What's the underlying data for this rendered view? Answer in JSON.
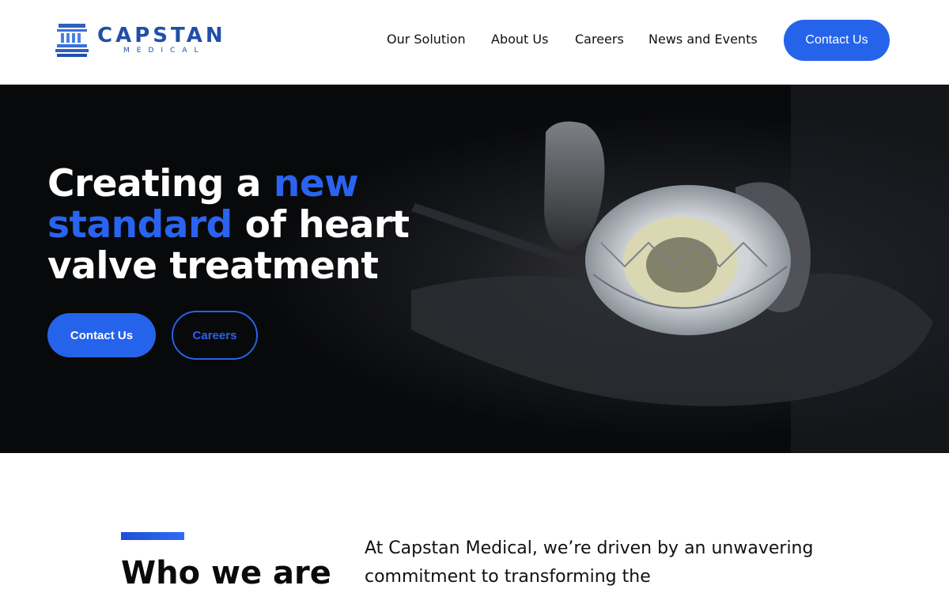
{
  "brand": {
    "name": "CAPSTAN",
    "subtitle": "MEDICAL",
    "accent_color": "#2563eb"
  },
  "nav": {
    "items": [
      {
        "label": "Our Solution"
      },
      {
        "label": "About Us"
      },
      {
        "label": "Careers"
      },
      {
        "label": "News and Events"
      }
    ],
    "cta_label": "Contact Us"
  },
  "hero": {
    "title_part1": "Creating a ",
    "title_accent1": "new",
    "title_accent2": "standard",
    "title_part2": " of heart valve treatment",
    "primary_button": "Contact Us",
    "secondary_button": "Careers",
    "image_icon": "heart-valve-photo"
  },
  "about": {
    "heading": "Who we are",
    "text": "At Capstan Medical, we’re driven by an unwavering commitment to transforming the"
  }
}
